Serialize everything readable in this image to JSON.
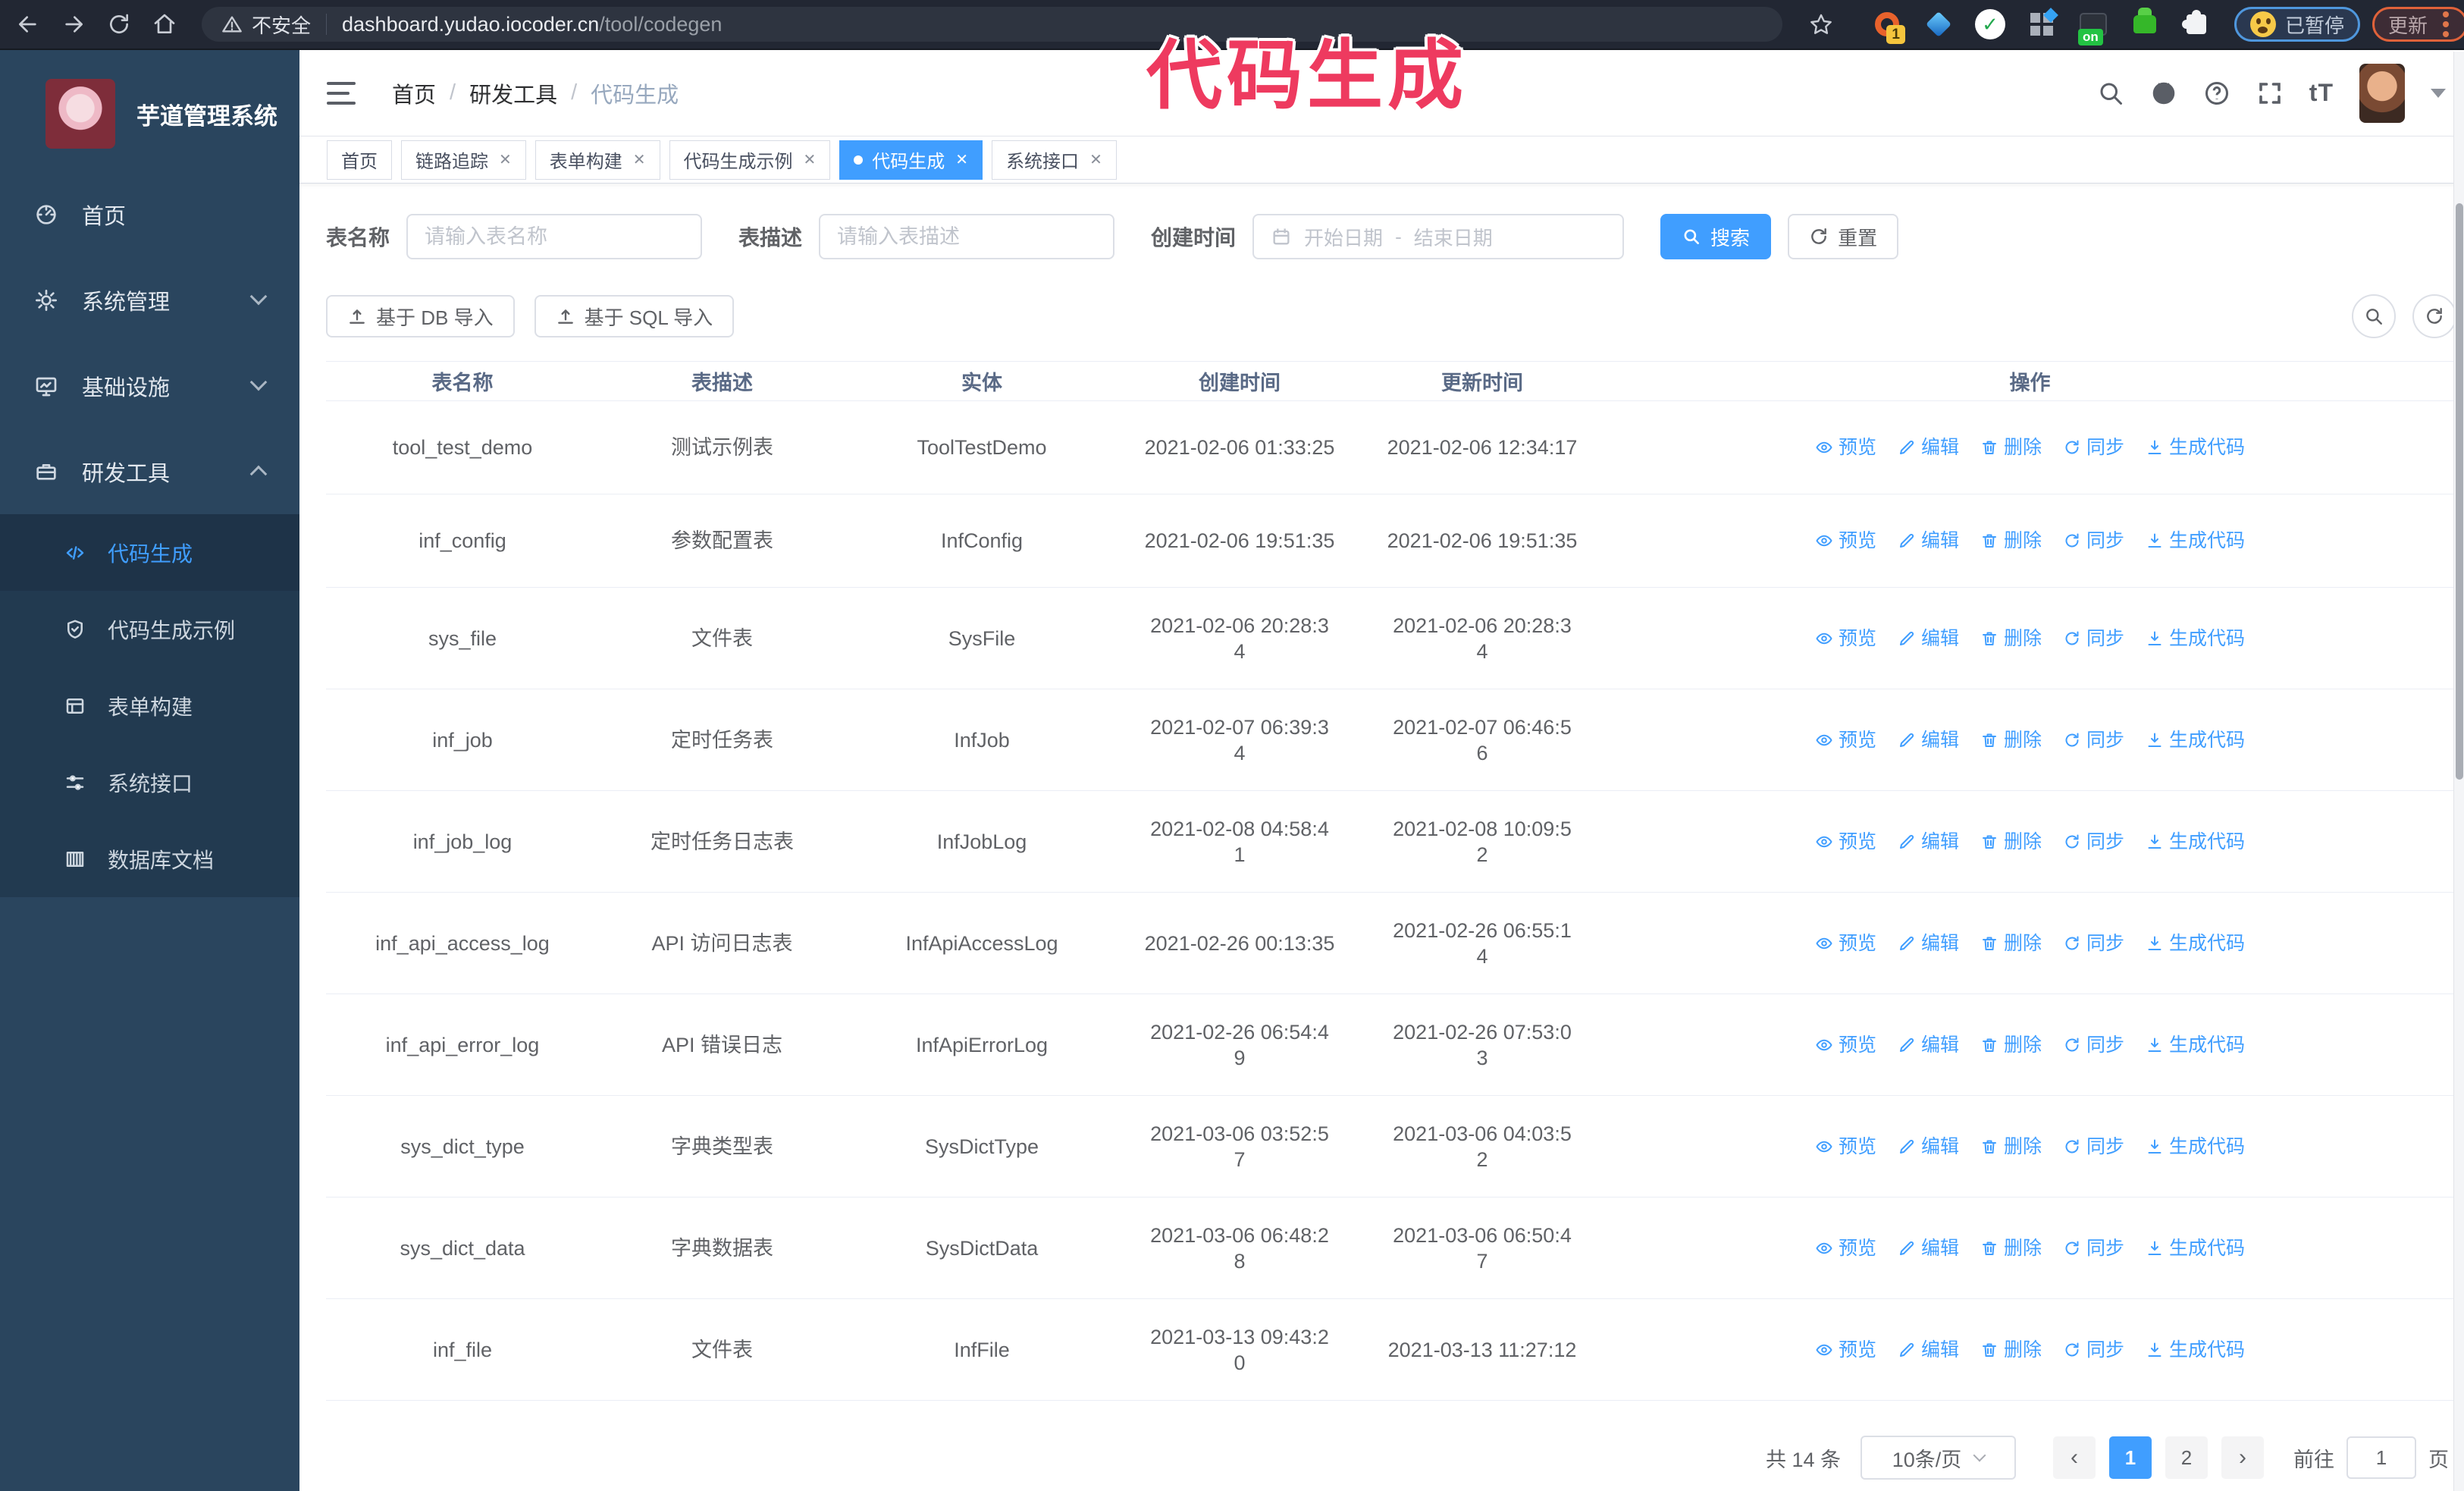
{
  "browser": {
    "security": "不安全",
    "url_host": "dashboard.yudao.iocoder.cn",
    "url_path": "/tool/codegen",
    "ext_badge_1": "1",
    "ext_on": "on",
    "paused_badge": "已暂停",
    "update_button": "更新"
  },
  "overlay": {
    "text": "代码生成",
    "color": "#ee3a5f"
  },
  "sidebar": {
    "title": "芋道管理系统",
    "items": [
      {
        "label": "首页",
        "icon": "dashboard",
        "chevron": ""
      },
      {
        "label": "系统管理",
        "icon": "gear",
        "chevron": "down"
      },
      {
        "label": "基础设施",
        "icon": "monitor",
        "chevron": "down"
      },
      {
        "label": "研发工具",
        "icon": "briefcase",
        "chevron": "up"
      }
    ],
    "submenu": [
      {
        "label": "代码生成",
        "icon": "code",
        "active": true
      },
      {
        "label": "代码生成示例",
        "icon": "shield",
        "active": false
      },
      {
        "label": "表单构建",
        "icon": "form",
        "active": false
      },
      {
        "label": "系统接口",
        "icon": "sliders",
        "active": false
      },
      {
        "label": "数据库文档",
        "icon": "dbdoc",
        "active": false
      }
    ]
  },
  "header": {
    "breadcrumb": [
      "首页",
      "研发工具",
      "代码生成"
    ],
    "font_size_icon_text": "tT"
  },
  "tabs": [
    {
      "label": "首页",
      "closable": false,
      "active": false
    },
    {
      "label": "链路追踪",
      "closable": true,
      "active": false
    },
    {
      "label": "表单构建",
      "closable": true,
      "active": false
    },
    {
      "label": "代码生成示例",
      "closable": true,
      "active": false
    },
    {
      "label": "代码生成",
      "closable": true,
      "active": true
    },
    {
      "label": "系统接口",
      "closable": true,
      "active": false
    }
  ],
  "filters": {
    "table_name_label": "表名称",
    "table_name_placeholder": "请输入表名称",
    "table_desc_label": "表描述",
    "table_desc_placeholder": "请输入表描述",
    "create_time_label": "创建时间",
    "start_placeholder": "开始日期",
    "range_separator": "-",
    "end_placeholder": "结束日期",
    "search_button": "搜索",
    "reset_button": "重置"
  },
  "toolbar": {
    "import_db": "基于 DB 导入",
    "import_sql": "基于 SQL 导入"
  },
  "table": {
    "columns": [
      "表名称",
      "表描述",
      "实体",
      "创建时间",
      "更新时间",
      "操作"
    ],
    "row_actions": [
      "预览",
      "编辑",
      "删除",
      "同步",
      "生成代码"
    ],
    "rows": [
      {
        "name": "tool_test_demo",
        "desc": "测试示例表",
        "entity": "ToolTestDemo",
        "created": "2021-02-06 01:33:25",
        "updated": "2021-02-06 12:34:17"
      },
      {
        "name": "inf_config",
        "desc": "参数配置表",
        "entity": "InfConfig",
        "created": "2021-02-06 19:51:35",
        "updated": "2021-02-06 19:51:35"
      },
      {
        "name": "sys_file",
        "desc": "文件表",
        "entity": "SysFile",
        "created": "2021-02-06 20:28:3\n4",
        "updated": "2021-02-06 20:28:3\n4"
      },
      {
        "name": "inf_job",
        "desc": "定时任务表",
        "entity": "InfJob",
        "created": "2021-02-07 06:39:3\n4",
        "updated": "2021-02-07 06:46:5\n6"
      },
      {
        "name": "inf_job_log",
        "desc": "定时任务日志表",
        "entity": "InfJobLog",
        "created": "2021-02-08 04:58:4\n1",
        "updated": "2021-02-08 10:09:5\n2"
      },
      {
        "name": "inf_api_access_log",
        "desc": "API 访问日志表",
        "entity": "InfApiAccessLog",
        "created": "2021-02-26 00:13:35",
        "updated": "2021-02-26 06:55:1\n4"
      },
      {
        "name": "inf_api_error_log",
        "desc": "API 错误日志",
        "entity": "InfApiErrorLog",
        "created": "2021-02-26 06:54:4\n9",
        "updated": "2021-02-26 07:53:0\n3"
      },
      {
        "name": "sys_dict_type",
        "desc": "字典类型表",
        "entity": "SysDictType",
        "created": "2021-03-06 03:52:5\n7",
        "updated": "2021-03-06 04:03:5\n2"
      },
      {
        "name": "sys_dict_data",
        "desc": "字典数据表",
        "entity": "SysDictData",
        "created": "2021-03-06 06:48:2\n8",
        "updated": "2021-03-06 06:50:4\n7"
      },
      {
        "name": "inf_file",
        "desc": "文件表",
        "entity": "InfFile",
        "created": "2021-03-13 09:43:2\n0",
        "updated": "2021-03-13 11:27:12"
      }
    ]
  },
  "pagination": {
    "total_text": "共 14 条",
    "page_size": "10条/页",
    "prev": "‹",
    "next": "›",
    "pages": [
      "1",
      "2"
    ],
    "active_page": "1",
    "goto_label": "前往",
    "goto_value": "1",
    "goto_suffix": "页"
  },
  "colors": {
    "accent": "#409eff",
    "sidebar_bg": "#2a455e",
    "overlay_pink": "#ee3a5f"
  }
}
